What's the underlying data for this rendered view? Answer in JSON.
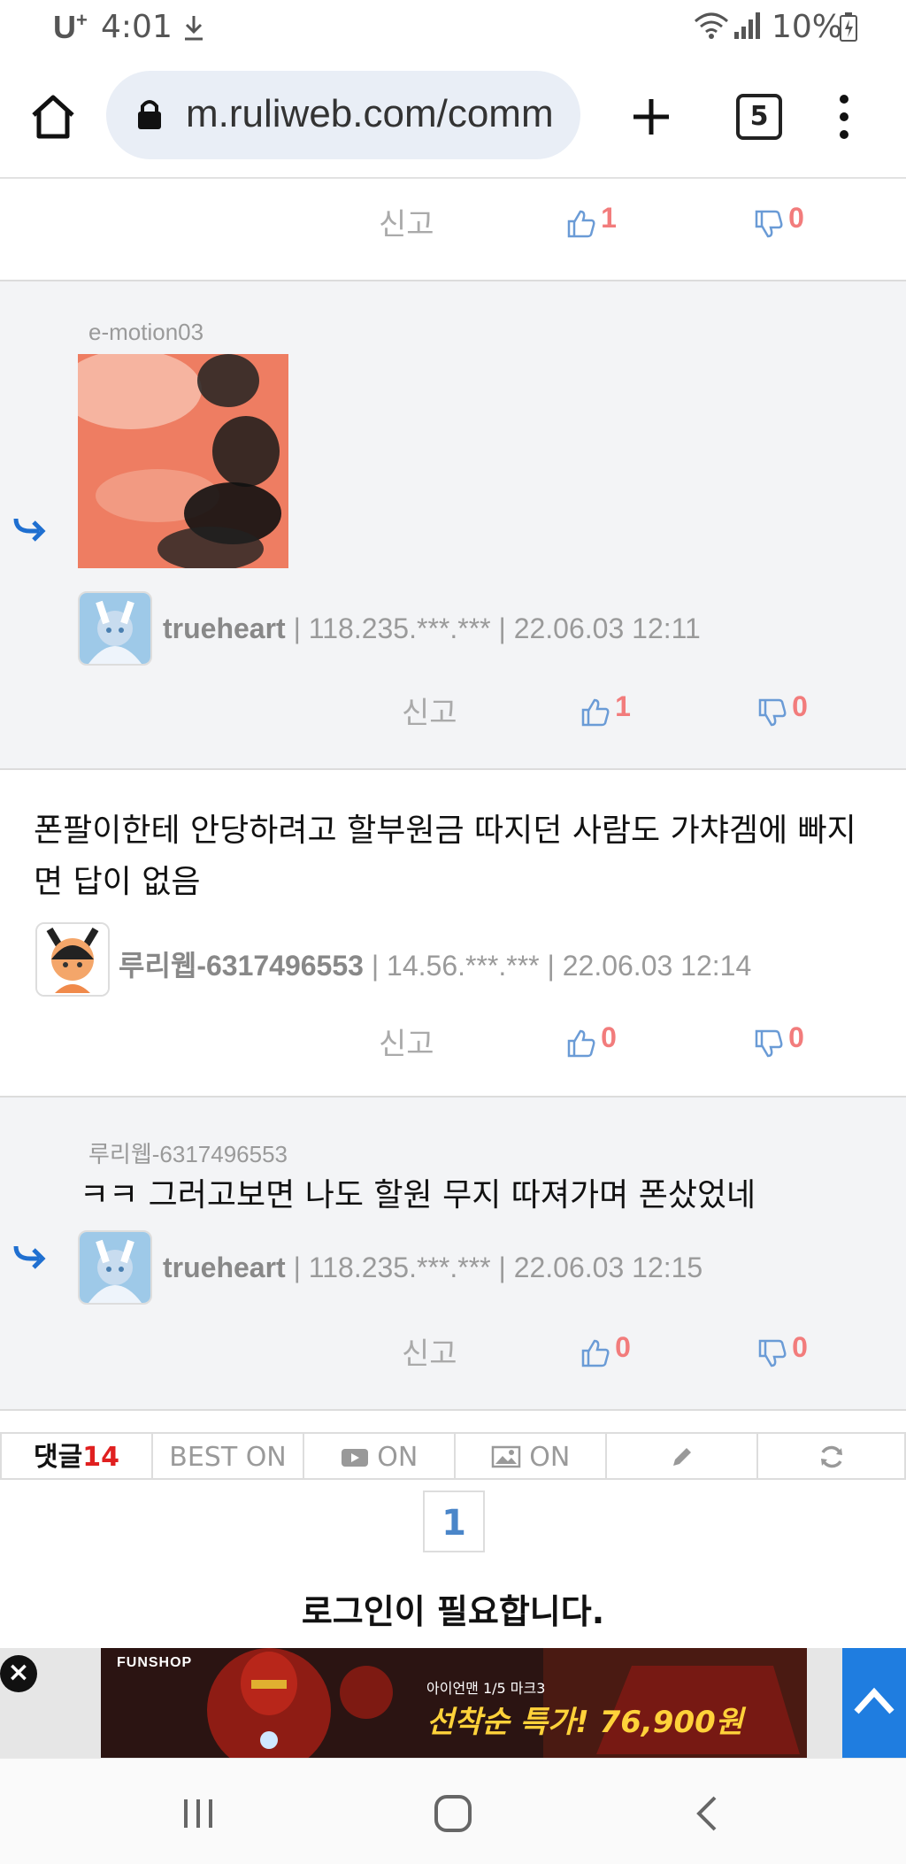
{
  "status_bar": {
    "carrier": "U",
    "carrier_sup": "+",
    "time": "4:01",
    "battery": "10%"
  },
  "browser": {
    "url": "m.ruliweb.com/comm",
    "tab_count": "5"
  },
  "comments": [
    {
      "report": "신고",
      "likes": "1",
      "dislikes": "0"
    },
    {
      "mention": "e-motion03",
      "author": "trueheart",
      "ip": "118.235.***.***",
      "date": "22.06.03 12:11",
      "report": "신고",
      "likes": "1",
      "dislikes": "0"
    },
    {
      "text": "폰팔이한테 안당하려고 할부원금 따지던 사람도 가챠겜에 빠지면 답이 없음",
      "author": "루리웹-6317496553",
      "ip": "14.56.***.***",
      "date": "22.06.03 12:14",
      "report": "신고",
      "likes": "0",
      "dislikes": "0"
    },
    {
      "mention": "루리웹-6317496553",
      "text": "ㅋㅋ 그러고보면 나도 할원 무지 따져가며 폰샀었네",
      "author": "trueheart",
      "ip": "118.235.***.***",
      "date": "22.06.03 12:15",
      "report": "신고",
      "likes": "0",
      "dislikes": "0"
    }
  ],
  "bottom_bar": {
    "comments_label": "댓글",
    "comments_count": "14",
    "best": "BEST ON",
    "video": "ON",
    "image": "ON"
  },
  "pagination": {
    "current": "1"
  },
  "login_notice": "로그인이 필요합니다.",
  "ad": {
    "brand": "FUNSHOP",
    "subtitle": "아이언맨 1/5 마크3",
    "headline": "선착순 특가! 76,900원"
  },
  "colors": {
    "accent": "#4a86c9",
    "vote": "#f27c7c",
    "count_red": "#e02020",
    "scroll_top": "#1f7de0"
  },
  "icons": [
    "home-icon",
    "lock-icon",
    "plus-icon",
    "more-icon",
    "thumbs-up-icon",
    "thumbs-down-icon",
    "reply-arrow-icon",
    "pencil-icon",
    "refresh-icon",
    "close-icon",
    "chevron-up-icon"
  ]
}
